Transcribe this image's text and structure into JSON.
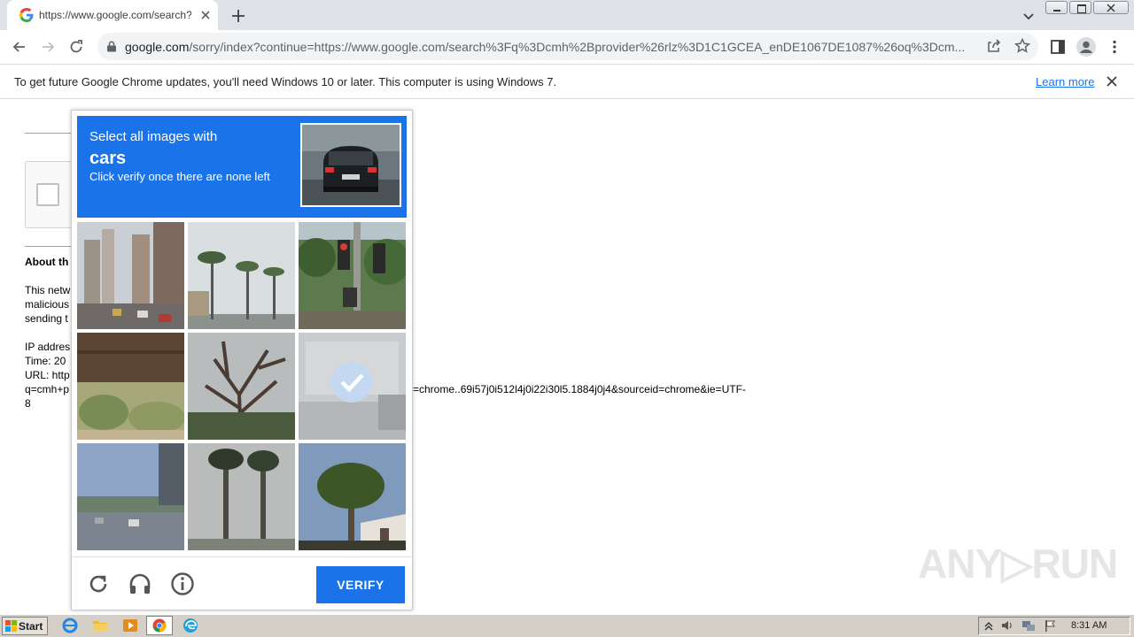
{
  "browser": {
    "tab_title": "https://www.google.com/search?q=",
    "url_host": "google.com",
    "url_path": "/sorry/index?continue=https://www.google.com/search%3Fq%3Dcmh%2Bprovider%26rlz%3D1C1GCEA_enDE1067DE1087%26oq%3Dcm...",
    "icons": [
      "back-icon",
      "forward-icon",
      "reload-icon",
      "lock-icon",
      "share-icon",
      "star-icon",
      "sidepanel-icon",
      "profile-icon",
      "menu-icon"
    ]
  },
  "infobar": {
    "message": "To get future Google Chrome updates, you'll need Windows 10 or later. This computer is using Windows 7.",
    "link": "Learn more"
  },
  "page": {
    "about": "About th",
    "line1": "This netw",
    "line2": "malicious",
    "line3": "sending t",
    "ip": "IP addres",
    "time": "Time: 20",
    "url_label": "URL: http",
    "url_tail": "q=cmh+p",
    "url_cont": "=chrome..69i57j0i512l4j0i22i30l5.1884j0j4&sourceid=chrome&ie=UTF-",
    "url_end": "8"
  },
  "captcha": {
    "line1": "Select all images with",
    "target": "cars",
    "line3": "Click verify once there are none left",
    "verify_label": "VERIFY",
    "selected_tile": 5,
    "footer_icons": [
      "reload-icon",
      "headphones-icon",
      "info-icon"
    ]
  },
  "watermark": "ANY▷RUN",
  "taskbar": {
    "start": "Start",
    "clock": "8:31 AM"
  }
}
